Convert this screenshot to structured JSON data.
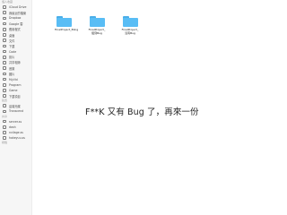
{
  "sidebar": {
    "sections": [
      {
        "heading": "個人收藏",
        "items": [
          {
            "label": "iCloud Drive",
            "icon": "cloud-icon"
          },
          {
            "label": "我最近的檔案",
            "icon": "clock-icon"
          },
          {
            "label": "Dropbox",
            "icon": "dropbox-icon"
          },
          {
            "label": "Google 雲",
            "icon": "drive-icon"
          },
          {
            "label": "應用程式",
            "icon": "apps-icon"
          },
          {
            "label": "桌面",
            "icon": "desktop-icon"
          },
          {
            "label": "文件",
            "icon": "document-icon"
          },
          {
            "label": "下載",
            "icon": "download-icon"
          },
          {
            "label": "Code",
            "icon": "folder-icon"
          },
          {
            "label": "影片",
            "icon": "movie-icon"
          },
          {
            "label": "共享相簿",
            "icon": "photos-icon"
          },
          {
            "label": "音樂",
            "icon": "music-icon"
          },
          {
            "label": "圖片",
            "icon": "picture-icon"
          },
          {
            "label": "MyVid",
            "icon": "folder-icon"
          },
          {
            "label": "Program",
            "icon": "folder-icon"
          },
          {
            "label": "Game",
            "icon": "folder-icon"
          },
          {
            "label": "下載項目",
            "icon": "download-icon"
          }
        ]
      },
      {
        "heading": "裝置",
        "items": [
          {
            "label": "遠端光碟",
            "icon": "disc-icon"
          },
          {
            "label": "Transcend",
            "icon": "drive-icon"
          }
        ]
      },
      {
        "heading": "共享",
        "items": [
          {
            "label": "server.ss",
            "icon": "network-icon"
          },
          {
            "label": "dash",
            "icon": "network-icon"
          },
          {
            "label": "nvilage.ss",
            "icon": "network-icon"
          },
          {
            "label": "hakeyuu.ss",
            "icon": "network-icon"
          }
        ]
      },
      {
        "heading": "標籤",
        "items": []
      }
    ]
  },
  "files": [
    {
      "label": "FinalProject_Bling",
      "icon": "folder-icon"
    },
    {
      "label": "FinalProject_復刻Bug",
      "icon": "folder-icon"
    },
    {
      "label": "FinalProject_沒有Bug",
      "icon": "folder-icon"
    }
  ],
  "headline": "F**K 又有 Bug 了，再來一份",
  "colors": {
    "folder": "#59bdf5",
    "sidebar_bg": "#f6f6f6"
  }
}
